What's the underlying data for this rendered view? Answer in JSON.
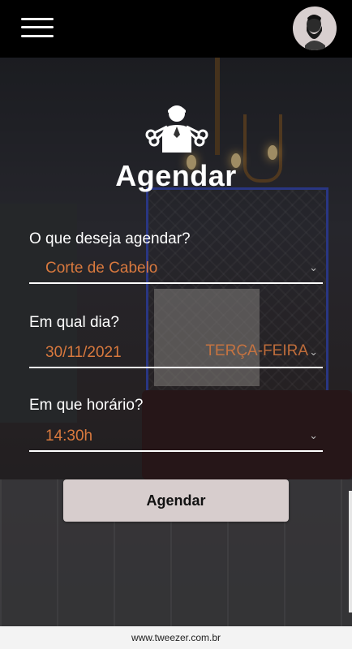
{
  "header": {
    "menu_icon": "hamburger-menu-icon",
    "avatar_icon": "bearded-man-avatar-icon"
  },
  "page": {
    "title": "Agendar",
    "logo_icon": "barber-scissors-icon"
  },
  "form": {
    "service": {
      "label": "O que deseja agendar?",
      "value": "Corte de Cabelo"
    },
    "date": {
      "label": "Em qual dia?",
      "value": "30/11/2021",
      "weekday": "TERÇA-FEIRA"
    },
    "time": {
      "label": "Em que horário?",
      "value": "14:30h"
    },
    "submit_label": "Agendar"
  },
  "footer": {
    "text": "www.tweezer.com.br"
  },
  "colors": {
    "accent": "#d9793e",
    "button_bg": "#d7cdcd",
    "header_bg": "#000000"
  }
}
